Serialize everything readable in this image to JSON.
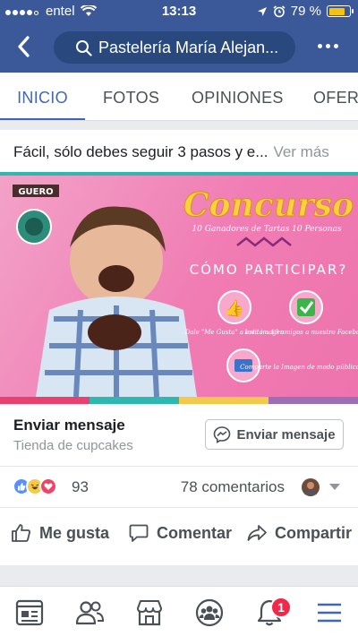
{
  "status_bar": {
    "carrier": "entel",
    "time": "13:13",
    "battery": "79 %"
  },
  "navbar": {
    "search_text": "Pastelería María Alejan..."
  },
  "tabs": [
    {
      "label": "INICIO",
      "active": true
    },
    {
      "label": "FOTOS",
      "active": false
    },
    {
      "label": "OPINIONES",
      "active": false
    },
    {
      "label": "OFERT",
      "active": false
    }
  ],
  "post": {
    "description": "Fácil, sólo debes seguir 3 pasos y e...",
    "see_more": "Ver más",
    "banner": {
      "title": "Concurso",
      "subtitle": "10 Ganadores de Tartas 10 Personas",
      "how": "CÓMO PARTICIPAR?",
      "step1": "Dale \"Me Gusta\" a esta imagen",
      "step2": "Invita a 10 amigos a nuestro Facebook",
      "step3": "Comparte la Imagen de modo público",
      "brand": "GUERO"
    },
    "colorbar": [
      "#e9406f",
      "#2eb8b0",
      "#f3c84b",
      "#9b6fb5"
    ]
  },
  "cta": {
    "title": "Enviar mensaje",
    "subtitle": "Tienda de cupcakes",
    "button_label": "Enviar mensaje"
  },
  "reactions": {
    "count": "93",
    "comments": "78 comentarios"
  },
  "actions": {
    "like": "Me gusta",
    "comment": "Comentar",
    "share": "Compartir"
  },
  "bottom_nav": {
    "notification_badge": "1"
  },
  "colors": {
    "facebook_blue": "#3b5998",
    "accent": "#4267b2",
    "badge_red": "#f02849"
  }
}
